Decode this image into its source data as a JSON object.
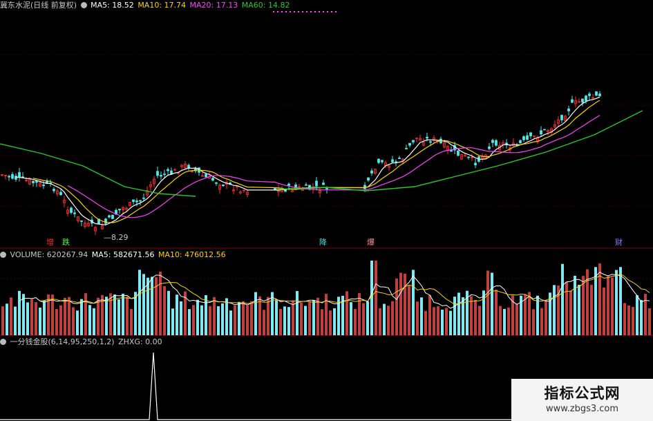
{
  "header": {
    "stock": "冀东水泥(日线 前复权)",
    "ma5": "MA5: 18.52",
    "ma10": "MA10: 17.74",
    "ma20": "MA20: 17.13",
    "ma60": "MA60: 14.82"
  },
  "price_panel": {
    "low_label": "8.29",
    "signals": [
      {
        "text": "增",
        "color": "#ff3030"
      },
      {
        "text": "跌",
        "color": "#40ff40"
      },
      {
        "text": "降",
        "color": "#40e0e0"
      },
      {
        "text": "爆",
        "color": "#ff9090"
      },
      {
        "text": "财",
        "color": "#8080ff"
      }
    ]
  },
  "volume_panel": {
    "volume": "VOLUME: 620267.94",
    "ma5": "MA5: 582671.56",
    "ma10": "MA10: 476012.56"
  },
  "indicator_panel": {
    "name": "一分钱金股(6,14,95,250,1,2)",
    "zhxg": "ZHXG: 0.00"
  },
  "watermark": {
    "title": "指标公式网",
    "url": "www.zbgs3.com"
  },
  "colors": {
    "up": "#ff3030",
    "down": "#50e8e8",
    "ma5": "#ffffff",
    "ma10": "#ffd200",
    "ma20": "#ff40ff",
    "ma60": "#28c828",
    "separator": "#8b0000"
  }
}
